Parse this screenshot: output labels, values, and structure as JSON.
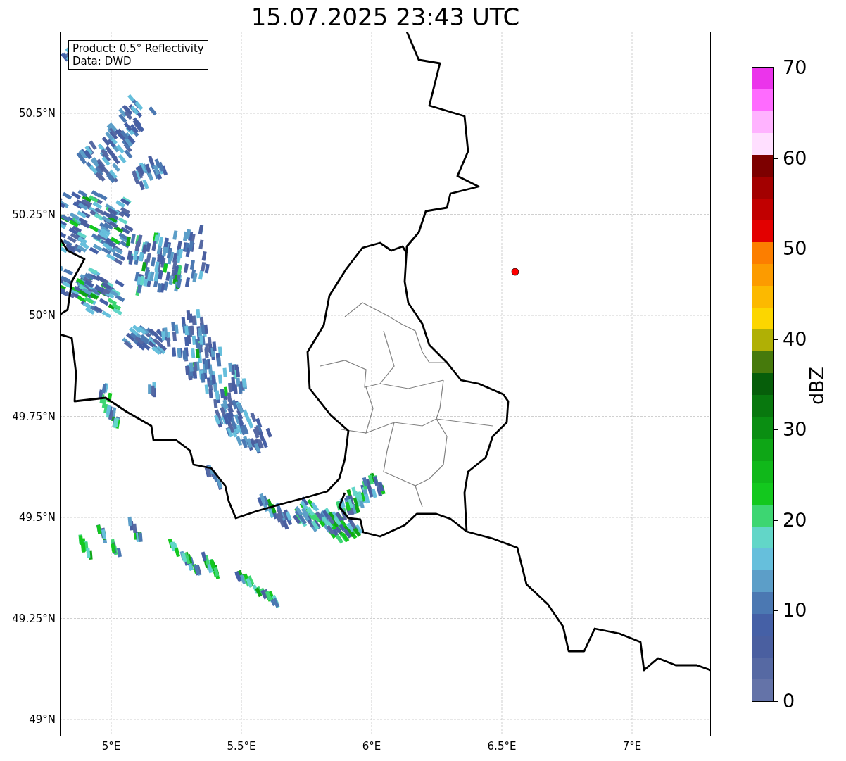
{
  "title": "15.07.2025 23:43 UTC",
  "legend": {
    "lines": [
      "Product: 0.5° Reflectivity",
      "Data: DWD"
    ]
  },
  "map": {
    "lon_ticks": [
      "5°E",
      "5.5°E",
      "6°E",
      "6.5°E",
      "7°E"
    ],
    "lat_ticks": [
      "50.5°N",
      "50.25°N",
      "50°N",
      "49.75°N",
      "49.5°N",
      "49.25°N",
      "49°N"
    ]
  },
  "colorbar": {
    "label": "dBZ",
    "ticks": [
      "70",
      "60",
      "50",
      "40",
      "30",
      "20",
      "10",
      "0"
    ],
    "segments": [
      {
        "color": "#eb34eb"
      },
      {
        "color": "#ff6bff"
      },
      {
        "color": "#ffb3ff"
      },
      {
        "color": "#ffdfff"
      },
      {
        "color": "#7d0000"
      },
      {
        "color": "#a30000"
      },
      {
        "color": "#c10000"
      },
      {
        "color": "#e30000"
      },
      {
        "color": "#fc7e00"
      },
      {
        "color": "#fc9b00"
      },
      {
        "color": "#fcb900"
      },
      {
        "color": "#fcd600"
      },
      {
        "color": "#b0b005"
      },
      {
        "color": "#467a0c"
      },
      {
        "color": "#065e0a"
      },
      {
        "color": "#08780e"
      },
      {
        "color": "#0a8e12"
      },
      {
        "color": "#0ea616"
      },
      {
        "color": "#10b81a"
      },
      {
        "color": "#13c81e"
      },
      {
        "color": "#3dd672"
      },
      {
        "color": "#62d6c8"
      },
      {
        "color": "#66bfdc"
      },
      {
        "color": "#5c9ec8"
      },
      {
        "color": "#4b78b2"
      },
      {
        "color": "#4560a6"
      },
      {
        "color": "#4a5fa0"
      },
      {
        "color": "#5669a3"
      },
      {
        "color": "#6473a8"
      }
    ]
  }
}
